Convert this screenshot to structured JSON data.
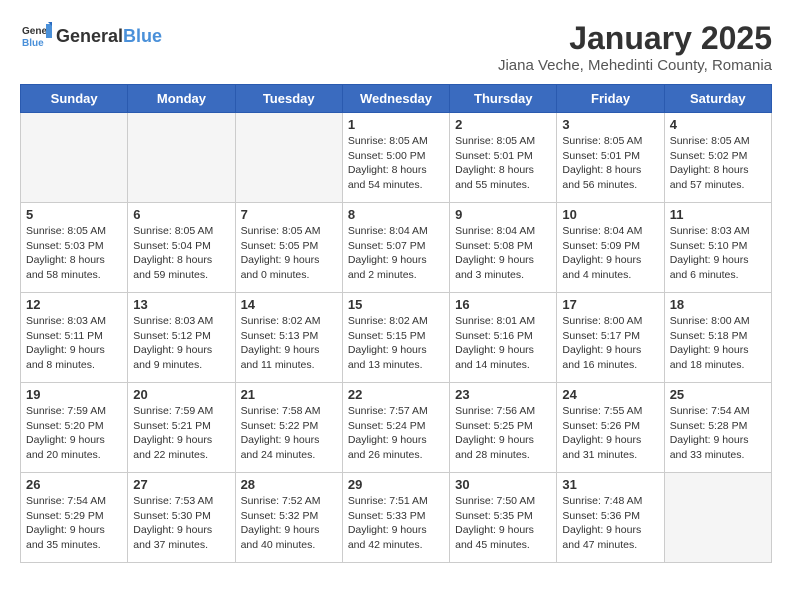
{
  "header": {
    "logo_general": "General",
    "logo_blue": "Blue",
    "title": "January 2025",
    "subtitle": "Jiana Veche, Mehedinti County, Romania"
  },
  "days_of_week": [
    "Sunday",
    "Monday",
    "Tuesday",
    "Wednesday",
    "Thursday",
    "Friday",
    "Saturday"
  ],
  "weeks": [
    [
      {
        "day": "",
        "empty": true
      },
      {
        "day": "",
        "empty": true
      },
      {
        "day": "",
        "empty": true
      },
      {
        "day": "1",
        "info": "Sunrise: 8:05 AM\nSunset: 5:00 PM\nDaylight: 8 hours\nand 54 minutes."
      },
      {
        "day": "2",
        "info": "Sunrise: 8:05 AM\nSunset: 5:01 PM\nDaylight: 8 hours\nand 55 minutes."
      },
      {
        "day": "3",
        "info": "Sunrise: 8:05 AM\nSunset: 5:01 PM\nDaylight: 8 hours\nand 56 minutes."
      },
      {
        "day": "4",
        "info": "Sunrise: 8:05 AM\nSunset: 5:02 PM\nDaylight: 8 hours\nand 57 minutes."
      }
    ],
    [
      {
        "day": "5",
        "info": "Sunrise: 8:05 AM\nSunset: 5:03 PM\nDaylight: 8 hours\nand 58 minutes."
      },
      {
        "day": "6",
        "info": "Sunrise: 8:05 AM\nSunset: 5:04 PM\nDaylight: 8 hours\nand 59 minutes."
      },
      {
        "day": "7",
        "info": "Sunrise: 8:05 AM\nSunset: 5:05 PM\nDaylight: 9 hours\nand 0 minutes."
      },
      {
        "day": "8",
        "info": "Sunrise: 8:04 AM\nSunset: 5:07 PM\nDaylight: 9 hours\nand 2 minutes."
      },
      {
        "day": "9",
        "info": "Sunrise: 8:04 AM\nSunset: 5:08 PM\nDaylight: 9 hours\nand 3 minutes."
      },
      {
        "day": "10",
        "info": "Sunrise: 8:04 AM\nSunset: 5:09 PM\nDaylight: 9 hours\nand 4 minutes."
      },
      {
        "day": "11",
        "info": "Sunrise: 8:03 AM\nSunset: 5:10 PM\nDaylight: 9 hours\nand 6 minutes."
      }
    ],
    [
      {
        "day": "12",
        "info": "Sunrise: 8:03 AM\nSunset: 5:11 PM\nDaylight: 9 hours\nand 8 minutes."
      },
      {
        "day": "13",
        "info": "Sunrise: 8:03 AM\nSunset: 5:12 PM\nDaylight: 9 hours\nand 9 minutes."
      },
      {
        "day": "14",
        "info": "Sunrise: 8:02 AM\nSunset: 5:13 PM\nDaylight: 9 hours\nand 11 minutes."
      },
      {
        "day": "15",
        "info": "Sunrise: 8:02 AM\nSunset: 5:15 PM\nDaylight: 9 hours\nand 13 minutes."
      },
      {
        "day": "16",
        "info": "Sunrise: 8:01 AM\nSunset: 5:16 PM\nDaylight: 9 hours\nand 14 minutes."
      },
      {
        "day": "17",
        "info": "Sunrise: 8:00 AM\nSunset: 5:17 PM\nDaylight: 9 hours\nand 16 minutes."
      },
      {
        "day": "18",
        "info": "Sunrise: 8:00 AM\nSunset: 5:18 PM\nDaylight: 9 hours\nand 18 minutes."
      }
    ],
    [
      {
        "day": "19",
        "info": "Sunrise: 7:59 AM\nSunset: 5:20 PM\nDaylight: 9 hours\nand 20 minutes."
      },
      {
        "day": "20",
        "info": "Sunrise: 7:59 AM\nSunset: 5:21 PM\nDaylight: 9 hours\nand 22 minutes."
      },
      {
        "day": "21",
        "info": "Sunrise: 7:58 AM\nSunset: 5:22 PM\nDaylight: 9 hours\nand 24 minutes."
      },
      {
        "day": "22",
        "info": "Sunrise: 7:57 AM\nSunset: 5:24 PM\nDaylight: 9 hours\nand 26 minutes."
      },
      {
        "day": "23",
        "info": "Sunrise: 7:56 AM\nSunset: 5:25 PM\nDaylight: 9 hours\nand 28 minutes."
      },
      {
        "day": "24",
        "info": "Sunrise: 7:55 AM\nSunset: 5:26 PM\nDaylight: 9 hours\nand 31 minutes."
      },
      {
        "day": "25",
        "info": "Sunrise: 7:54 AM\nSunset: 5:28 PM\nDaylight: 9 hours\nand 33 minutes."
      }
    ],
    [
      {
        "day": "26",
        "info": "Sunrise: 7:54 AM\nSunset: 5:29 PM\nDaylight: 9 hours\nand 35 minutes."
      },
      {
        "day": "27",
        "info": "Sunrise: 7:53 AM\nSunset: 5:30 PM\nDaylight: 9 hours\nand 37 minutes."
      },
      {
        "day": "28",
        "info": "Sunrise: 7:52 AM\nSunset: 5:32 PM\nDaylight: 9 hours\nand 40 minutes."
      },
      {
        "day": "29",
        "info": "Sunrise: 7:51 AM\nSunset: 5:33 PM\nDaylight: 9 hours\nand 42 minutes."
      },
      {
        "day": "30",
        "info": "Sunrise: 7:50 AM\nSunset: 5:35 PM\nDaylight: 9 hours\nand 45 minutes."
      },
      {
        "day": "31",
        "info": "Sunrise: 7:48 AM\nSunset: 5:36 PM\nDaylight: 9 hours\nand 47 minutes."
      },
      {
        "day": "",
        "empty": true
      }
    ]
  ]
}
